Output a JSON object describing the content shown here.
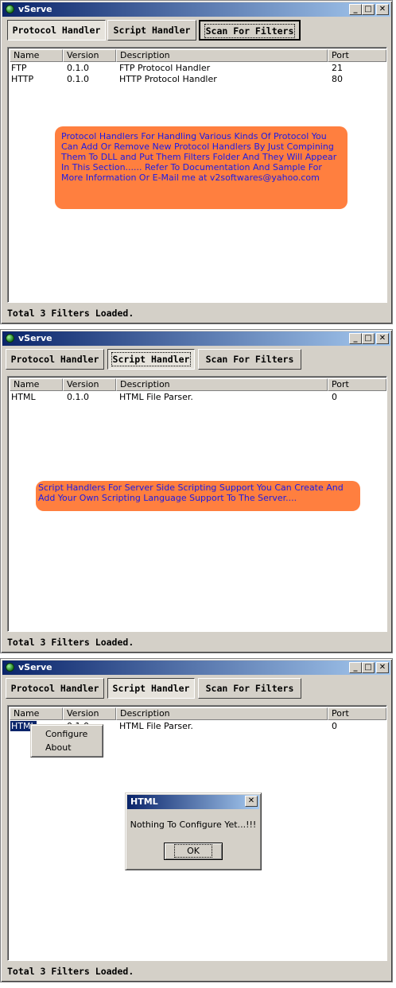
{
  "app_title": "vServe",
  "window_controls": {
    "minimize": "_",
    "maximize": "□",
    "close": "✕"
  },
  "tabs": [
    "Protocol Handler",
    "Script Handler",
    "Scan For Filters"
  ],
  "columns": [
    "Name",
    "Version",
    "Description",
    "Port"
  ],
  "status": "Total 3 Filters Loaded.",
  "panels": [
    {
      "selected_tab": "Protocol Handler",
      "rows": [
        {
          "name": "FTP",
          "version": "0.1.0",
          "description": "FTP Protocol Handler",
          "port": "21"
        },
        {
          "name": "HTTP",
          "version": "0.1.0",
          "description": "HTTP Protocol Handler",
          "port": "80"
        }
      ],
      "note": "Protocol Handlers For Handling Various Kinds Of Protocol You Can Add Or Remove New Protocol Handlers By Just Compining Them To DLL and Put Them Filters Folder And They Will Appear In This Section...... Refer To Documentation And Sample For More Information Or E-Mail me at v2softwares@yahoo.com"
    },
    {
      "selected_tab": "Script Handler",
      "rows": [
        {
          "name": "HTML",
          "version": "0.1.0",
          "description": "HTML File Parser.",
          "port": "0"
        }
      ],
      "note": "Script Handlers For Server Side Scripting Support You Can Create And Add Your Own Scripting Language Support To The Server...."
    },
    {
      "selected_tab": "Script Handler",
      "rows": [
        {
          "name": "HTML",
          "version": "0.1.0",
          "description": "HTML File Parser.",
          "port": "0"
        }
      ],
      "context_menu": [
        "Configure",
        "About"
      ],
      "dialog": {
        "title": "HTML",
        "message": "Nothing To Configure Yet...!!!",
        "ok": "OK"
      }
    }
  ],
  "colors": {
    "note_bg": "#ff7f3f",
    "note_text": "#1a1ae8",
    "titlebar_start": "#0a246a",
    "titlebar_end": "#a6caf0"
  },
  "icons": {
    "app": "globe-icon"
  }
}
